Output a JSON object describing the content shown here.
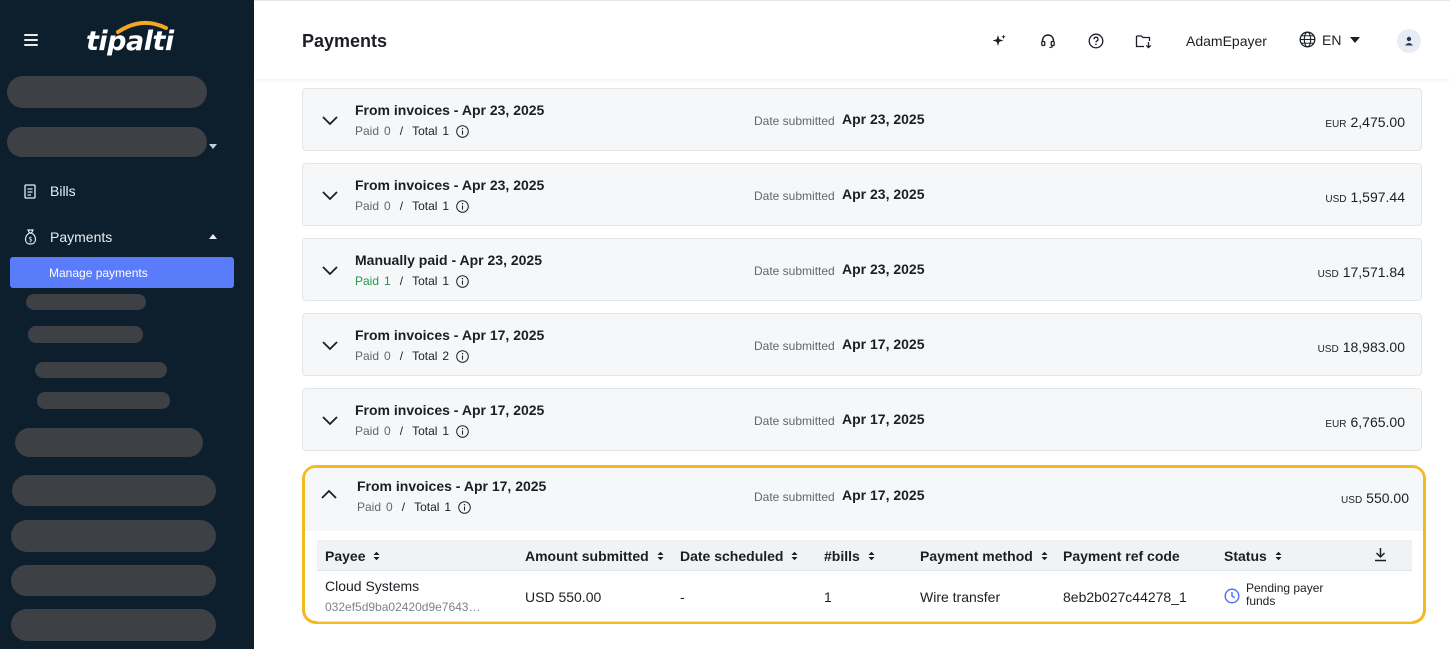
{
  "sidebar": {
    "logo": "tipalti",
    "items": [
      {
        "label": "Bills"
      },
      {
        "label": "Payments"
      },
      {
        "label": "Manage payments"
      }
    ]
  },
  "header": {
    "title": "Payments",
    "user": "AdamEpayer",
    "language": "EN"
  },
  "batches": [
    {
      "title": "From invoices - Apr 23, 2025",
      "paid_label": "Paid",
      "paid": "0",
      "total_label": "Total",
      "total": "1",
      "date_label": "Date submitted",
      "date": "Apr 23, 2025",
      "currency": "EUR",
      "amount": "2,475.00"
    },
    {
      "title": "From invoices - Apr 23, 2025",
      "paid_label": "Paid",
      "paid": "0",
      "total_label": "Total",
      "total": "1",
      "date_label": "Date submitted",
      "date": "Apr 23, 2025",
      "currency": "USD",
      "amount": "1,597.44"
    },
    {
      "title": "Manually paid - Apr 23, 2025",
      "paid_label": "Paid",
      "paid": "1",
      "total_label": "Total",
      "total": "1",
      "date_label": "Date submitted",
      "date": "Apr 23, 2025",
      "currency": "USD",
      "amount": "17,571.84"
    },
    {
      "title": "From invoices - Apr 17, 2025",
      "paid_label": "Paid",
      "paid": "0",
      "total_label": "Total",
      "total": "2",
      "date_label": "Date submitted",
      "date": "Apr 17, 2025",
      "currency": "USD",
      "amount": "18,983.00"
    },
    {
      "title": "From invoices - Apr 17, 2025",
      "paid_label": "Paid",
      "paid": "0",
      "total_label": "Total",
      "total": "1",
      "date_label": "Date submitted",
      "date": "Apr 17, 2025",
      "currency": "EUR",
      "amount": "6,765.00"
    },
    {
      "title": "From invoices - Apr 17, 2025",
      "paid_label": "Paid",
      "paid": "0",
      "total_label": "Total",
      "total": "1",
      "date_label": "Date submitted",
      "date": "Apr 17, 2025",
      "currency": "USD",
      "amount": "550.00"
    }
  ],
  "table": {
    "headers": {
      "payee": "Payee",
      "amount": "Amount submitted",
      "date_scheduled": "Date scheduled",
      "bills": "#bills",
      "method": "Payment method",
      "ref": "Payment ref code",
      "status": "Status"
    },
    "row": {
      "payee_name": "Cloud Systems",
      "payee_id": "032ef5d9ba02420d9e7643…",
      "amount": "USD 550.00",
      "date_scheduled": "-",
      "bills": "1",
      "method": "Wire transfer",
      "ref": "8eb2b027c44278_1",
      "status": "Pending payer funds"
    }
  },
  "colors": {
    "sidebar_bg": "#0d1f2d",
    "active_nav": "#5b7cfa",
    "highlight": "#f5b820",
    "paid_green": "#1e9a4a"
  }
}
